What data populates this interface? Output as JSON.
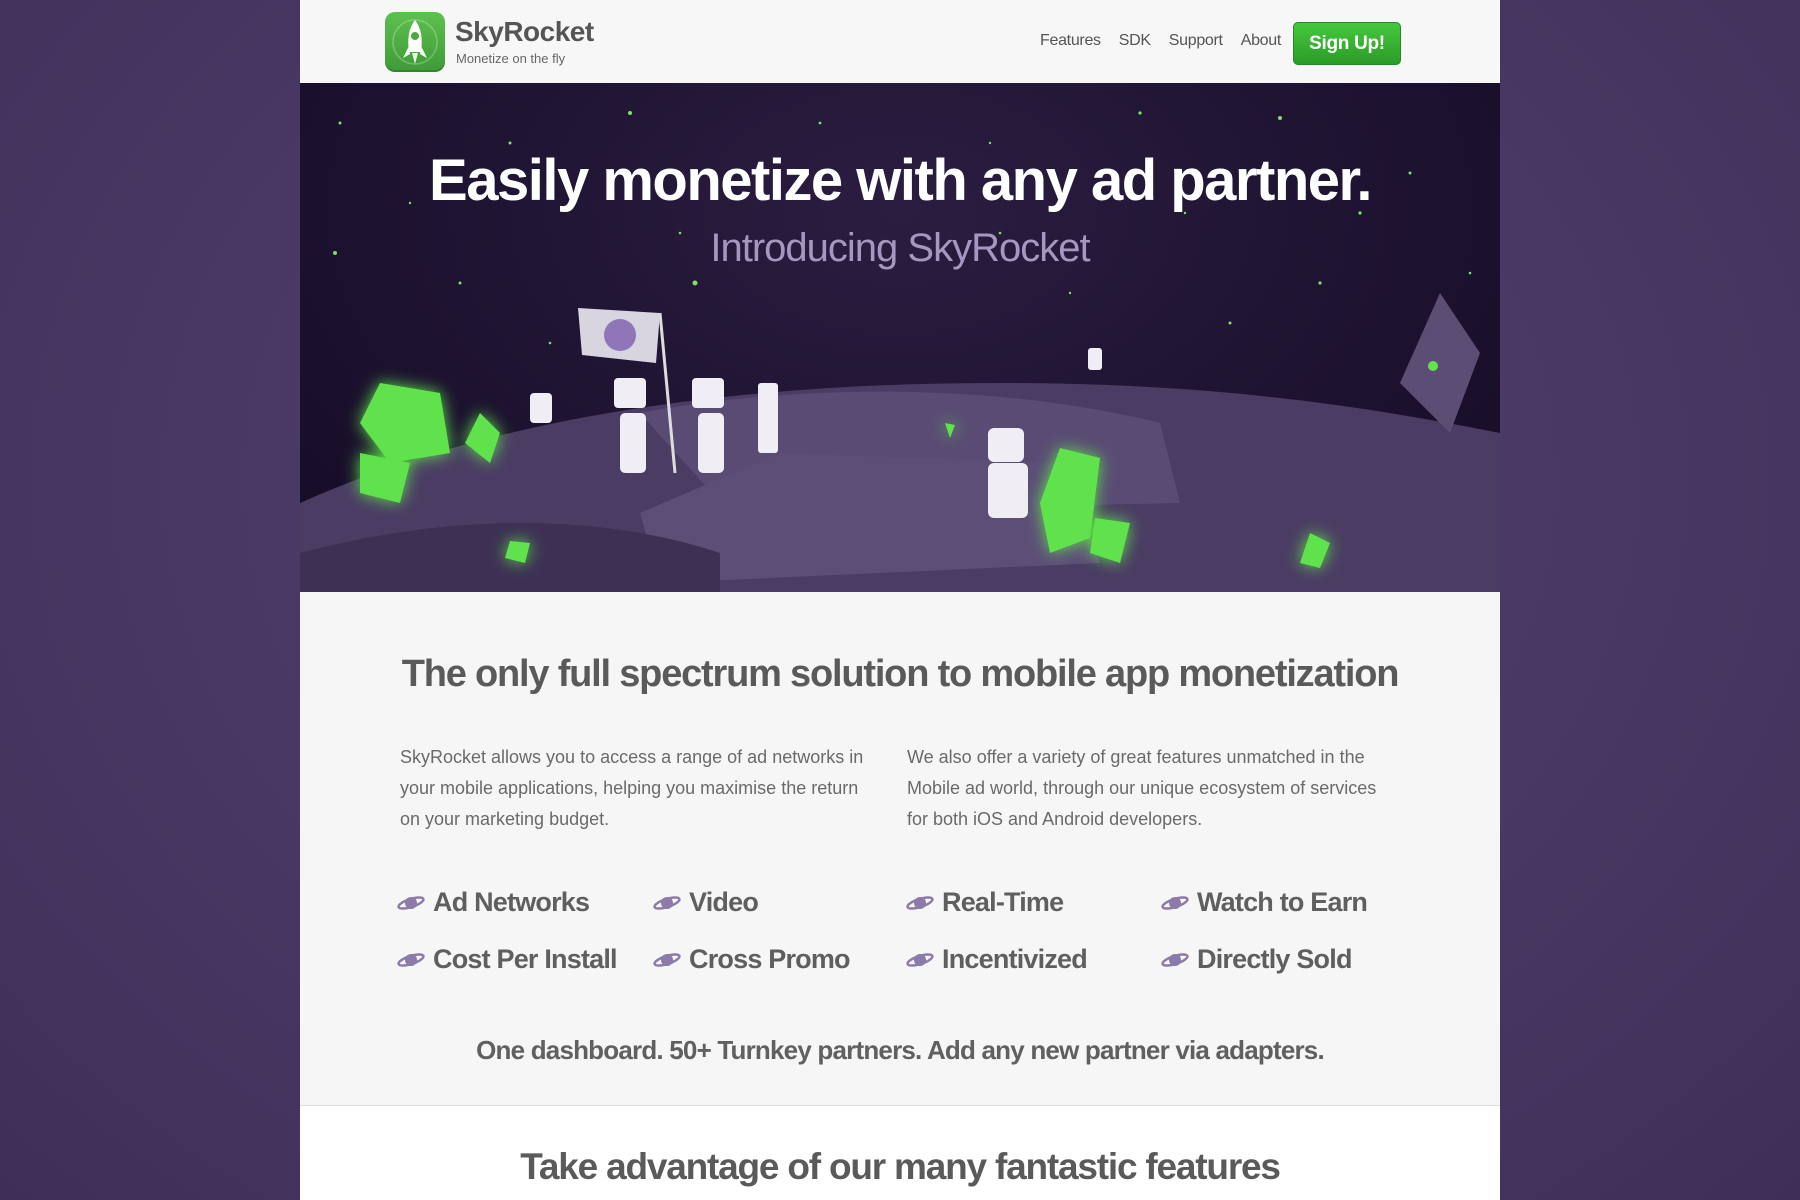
{
  "brand": {
    "name": "SkyRocket",
    "tagline": "Monetize on the fly"
  },
  "nav": {
    "items": [
      {
        "label": "Features"
      },
      {
        "label": "SDK"
      },
      {
        "label": "Support"
      },
      {
        "label": "About"
      }
    ],
    "signup_label": "Sign Up!"
  },
  "hero": {
    "title": "Easily monetize with any ad partner.",
    "subtitle": "Introducing SkyRocket"
  },
  "intro": {
    "heading": "The only full spectrum solution to mobile app monetization",
    "left_paragraph": "SkyRocket allows you to access a range of ad networks in your mobile applications, helping you maximise the return on your marketing budget.",
    "right_paragraph": "We also offer a variety of great features unmatched in the Mobile ad world, through our unique ecosystem of services for both iOS and Android developers."
  },
  "features": [
    {
      "label": "Ad Networks",
      "icon": "planet-icon"
    },
    {
      "label": "Video",
      "icon": "planet-icon"
    },
    {
      "label": "Real-Time",
      "icon": "planet-icon"
    },
    {
      "label": "Watch to Earn",
      "icon": "planet-icon"
    },
    {
      "label": "Cost Per Install",
      "icon": "planet-icon"
    },
    {
      "label": "Cross Promo",
      "icon": "planet-icon"
    },
    {
      "label": "Incentivized",
      "icon": "planet-icon"
    },
    {
      "label": "Directly Sold",
      "icon": "planet-icon"
    }
  ],
  "dashboard_line": "One dashboard. 50+ Turnkey partners. Add any new partner via adapters.",
  "section2": {
    "heading": "Take advantage of our many fantastic features"
  },
  "colors": {
    "accent": "#3cb035",
    "background": "#4b3a66",
    "hero_bg": "#1d1230",
    "crystal": "#5ee04a",
    "planet_icon": "#8c7aaa"
  }
}
